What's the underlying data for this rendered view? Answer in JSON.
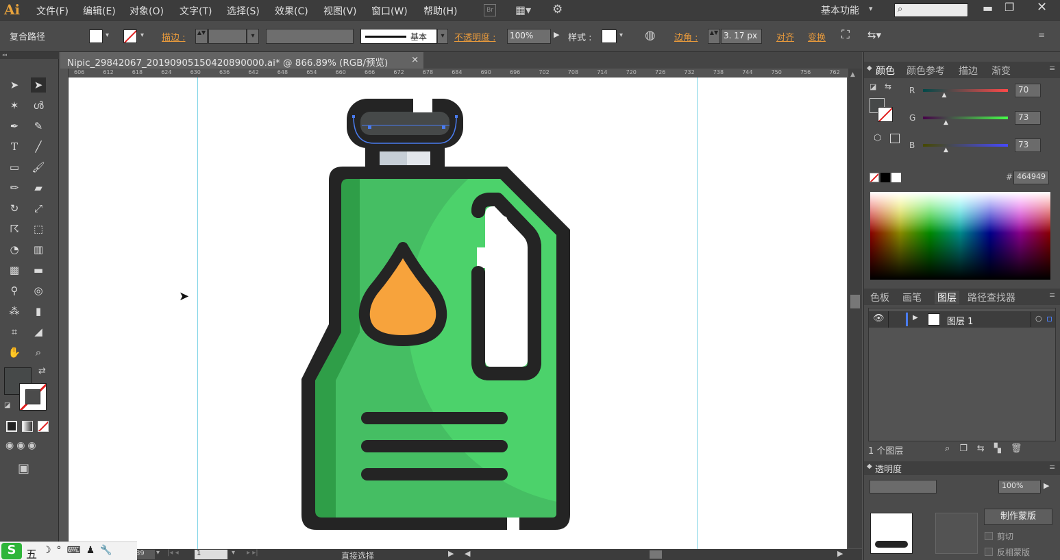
{
  "app": {
    "logo": "Ai"
  },
  "menu": [
    "文件(F)",
    "编辑(E)",
    "对象(O)",
    "文字(T)",
    "选择(S)",
    "效果(C)",
    "视图(V)",
    "窗口(W)",
    "帮助(H)"
  ],
  "workspace": {
    "label": "基本功能"
  },
  "control_bar": {
    "selection_type": "复合路径",
    "stroke_label": "描边 :",
    "stroke_style": "基本",
    "opacity_label": "不透明度 :",
    "opacity_value": "100%",
    "style_label": "样式 :",
    "corner_label": "边角 :",
    "corner_value": "3. 17  px",
    "align_label": "对齐",
    "transform_label": "变换"
  },
  "document": {
    "tab_title": "Nipic_29842067_20190905150420890000.ai* @ 866.89% (RGB/预览)",
    "close": "×"
  },
  "ruler": {
    "ticks": [
      "606",
      "612",
      "618",
      "624",
      "630",
      "636",
      "642",
      "648",
      "654",
      "660",
      "666",
      "672",
      "678",
      "684",
      "690",
      "696",
      "702",
      "708",
      "714",
      "720",
      "726",
      "732",
      "738",
      "744",
      "750",
      "756",
      "762"
    ]
  },
  "color_panel": {
    "tabs": [
      "颜色",
      "颜色参考",
      "描边",
      "渐变"
    ],
    "channels": [
      {
        "name": "R",
        "value": "70",
        "level": 0.27
      },
      {
        "name": "G",
        "value": "73",
        "level": 0.29
      },
      {
        "name": "B",
        "value": "73",
        "level": 0.29
      }
    ],
    "hex_label": "#",
    "hex": "464949"
  },
  "layers_panel": {
    "tabs": [
      "色板",
      "画笔",
      "图层",
      "路径查找器"
    ],
    "layers": [
      {
        "name": "图层  1"
      }
    ],
    "count": "1 个图层"
  },
  "transparency_panel": {
    "title": "透明度",
    "opacity": "100%",
    "make_mask": "制作蒙版",
    "clip": "剪切",
    "invert": "反相蒙版"
  },
  "status": {
    "zoom": "89",
    "page": "1",
    "tool": "直接选择"
  },
  "ime": {
    "mode": "五"
  },
  "colors": {
    "bottle_main": "#4cd26b",
    "bottle_shade": "#45be63",
    "bottle_dark": "#2f9e48",
    "outline": "#242424",
    "cap": "#464949",
    "neck": "#c6ced6",
    "drop": "#f7a33c",
    "accent_link": "#e89a3c"
  },
  "icons": [
    "selection-tool",
    "direct-selection-tool",
    "magic-wand",
    "lasso",
    "pen",
    "curvature",
    "type",
    "line",
    "rectangle",
    "paintbrush",
    "pencil",
    "eraser",
    "rotate",
    "scale",
    "warp",
    "free-transform",
    "shape-builder",
    "chart",
    "mesh",
    "gradient",
    "eyedropper",
    "blend",
    "symbol-sprayer",
    "column-graph",
    "artboard",
    "slice",
    "hand",
    "zoom"
  ]
}
